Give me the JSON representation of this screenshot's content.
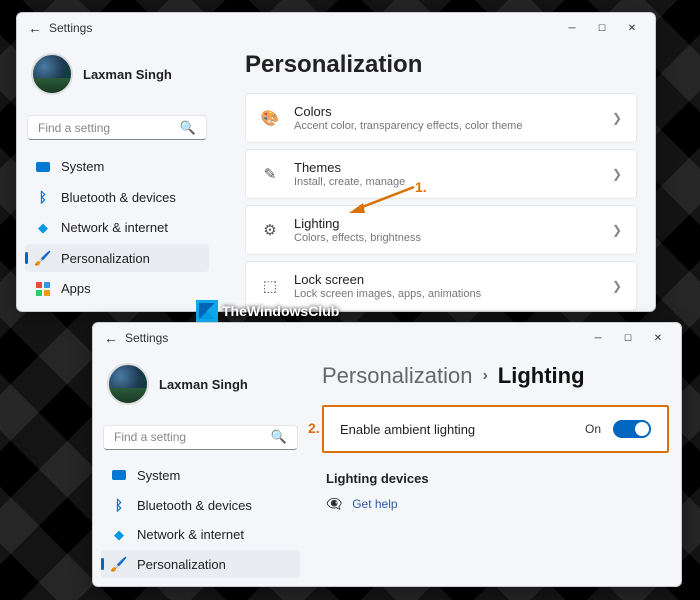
{
  "watermark": "TheWindowsClub",
  "annotations": {
    "step1": "1.",
    "step2": "2."
  },
  "win1": {
    "title": "Settings",
    "user": "Laxman Singh",
    "search_placeholder": "Find a setting",
    "page_title": "Personalization",
    "nav": [
      {
        "label": "System"
      },
      {
        "label": "Bluetooth & devices"
      },
      {
        "label": "Network & internet"
      },
      {
        "label": "Personalization"
      },
      {
        "label": "Apps"
      }
    ],
    "cards": [
      {
        "title": "Colors",
        "desc": "Accent color, transparency effects, color theme"
      },
      {
        "title": "Themes",
        "desc": "Install, create, manage"
      },
      {
        "title": "Lighting",
        "desc": "Colors, effects, brightness"
      },
      {
        "title": "Lock screen",
        "desc": "Lock screen images, apps, animations"
      }
    ]
  },
  "win2": {
    "title": "Settings",
    "user": "Laxman Singh",
    "search_placeholder": "Find a setting",
    "breadcrumb_parent": "Personalization",
    "breadcrumb_current": "Lighting",
    "nav": [
      {
        "label": "System"
      },
      {
        "label": "Bluetooth & devices"
      },
      {
        "label": "Network & internet"
      },
      {
        "label": "Personalization"
      }
    ],
    "ambient_label": "Enable ambient lighting",
    "ambient_state": "On",
    "devices_header": "Lighting devices",
    "get_help": "Get help"
  }
}
